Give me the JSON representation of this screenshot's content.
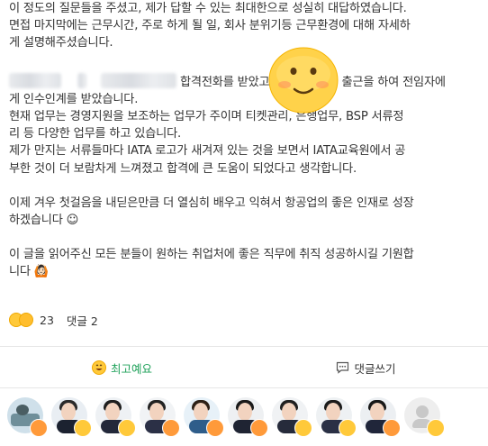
{
  "post": {
    "p1": [
      "이 정도의 질문들을 주셨고, 제가 답할 수 있는 최대한으로 성실히 대답하였습니다.",
      "면접 마지막에는 근무시간, 주로 하게 될 일, 회사 분위기등 근무환경에 대해 자세하",
      "게 설명해주셨습니다."
    ],
    "p2_line1_a": "합격전화를 받았고",
    "p2_line1_b": "출근을 하여 전임자에",
    "p2_line2": "게 인수인계를 받았습니다.",
    "p2_rest": [
      "현재 업무는 경영지원을 보조하는 업무가 주이며 티켓관리, 은행업무, BSP 서류정",
      "리 등 다양한 업무를 하고 있습니다.",
      "제가 만지는 서류들마다 IATA 로고가 새겨져 있는 것을 보면서 IATA교육원에서 공",
      "부한 것이 더 보람차게 느껴졌고 합격에 큰 도움이 되었다고 생각합니다."
    ],
    "p3": [
      "이제 겨우 첫걸음을 내딛은만큼 더 열심히 배우고 익혀서 항공업의 좋은 인재로 성장",
      "하겠습니다 ☺"
    ],
    "p4": [
      "이 글을 읽어주신 모든 분들이 원하는 취업처에 좋은 직무에 취직 성공하시길 기원합",
      "니다 🙆🏻"
    ]
  },
  "reactions": {
    "count": "23",
    "comments": "댓글 2"
  },
  "actions": {
    "like": "최고예요",
    "comment": "댓글쓰기"
  },
  "colors": {
    "like_green": "#1fa15a",
    "emoji_yellow": "#ffc93a"
  },
  "avatars": [
    "love-emoji",
    "laugh-emoji",
    "smile-emoji",
    "love-emoji",
    "love-emoji",
    "love-emoji",
    "smile-emoji",
    "smile-emoji",
    "love-emoji",
    "smile-emoji"
  ]
}
